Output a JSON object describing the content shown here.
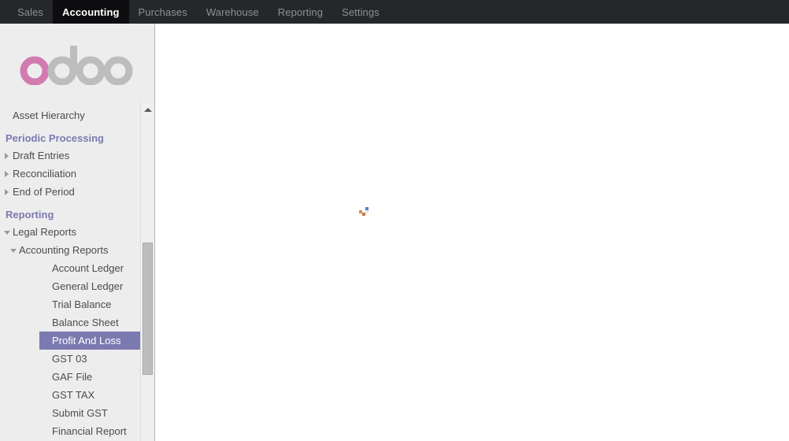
{
  "topbar": {
    "tabs": [
      {
        "label": "Sales",
        "active": false
      },
      {
        "label": "Accounting",
        "active": true
      },
      {
        "label": "Purchases",
        "active": false
      },
      {
        "label": "Warehouse",
        "active": false
      },
      {
        "label": "Reporting",
        "active": false
      },
      {
        "label": "Settings",
        "active": false
      }
    ]
  },
  "brand": {
    "name": "odoo",
    "accent_color": "#d17bb0",
    "gray_color": "#bdbdbd"
  },
  "sidebar": {
    "background_color": "#eeedee",
    "section_color": "#7b7ab0",
    "selected_background": "#7b7ab0",
    "selected_text_color": "#ffffff",
    "items": [
      {
        "label": "Asset Hierarchy",
        "type": "item",
        "level": 1,
        "caret": "none",
        "selected": false
      },
      {
        "label": "Periodic Processing",
        "type": "section",
        "level": 0,
        "caret": "none",
        "selected": false
      },
      {
        "label": "Draft Entries",
        "type": "item",
        "level": 1,
        "caret": "right",
        "selected": false
      },
      {
        "label": "Reconciliation",
        "type": "item",
        "level": 1,
        "caret": "right",
        "selected": false
      },
      {
        "label": "End of Period",
        "type": "item",
        "level": 1,
        "caret": "right",
        "selected": false
      },
      {
        "label": "Reporting",
        "type": "section",
        "level": 0,
        "caret": "none",
        "selected": false
      },
      {
        "label": "Legal Reports",
        "type": "item",
        "level": 1,
        "caret": "down",
        "selected": false
      },
      {
        "label": "Accounting Reports",
        "type": "item",
        "level": 2,
        "caret": "down",
        "selected": false
      },
      {
        "label": "Account Ledger",
        "type": "item",
        "level": 3,
        "caret": "none",
        "selected": false
      },
      {
        "label": "General Ledger",
        "type": "item",
        "level": 3,
        "caret": "none",
        "selected": false
      },
      {
        "label": "Trial Balance",
        "type": "item",
        "level": 3,
        "caret": "none",
        "selected": false
      },
      {
        "label": "Balance Sheet",
        "type": "item",
        "level": 3,
        "caret": "none",
        "selected": false
      },
      {
        "label": "Profit And Loss",
        "type": "item",
        "level": 3,
        "caret": "none",
        "selected": true
      },
      {
        "label": "GST 03",
        "type": "item",
        "level": 3,
        "caret": "none",
        "selected": false
      },
      {
        "label": "GAF File",
        "type": "item",
        "level": 3,
        "caret": "none",
        "selected": false
      },
      {
        "label": "GST TAX",
        "type": "item",
        "level": 3,
        "caret": "none",
        "selected": false
      },
      {
        "label": "Submit GST",
        "type": "item",
        "level": 3,
        "caret": "none",
        "selected": false
      },
      {
        "label": "Financial Report",
        "type": "item",
        "level": 3,
        "caret": "none",
        "selected": false
      }
    ]
  },
  "main": {
    "state": "loading",
    "content": ""
  }
}
